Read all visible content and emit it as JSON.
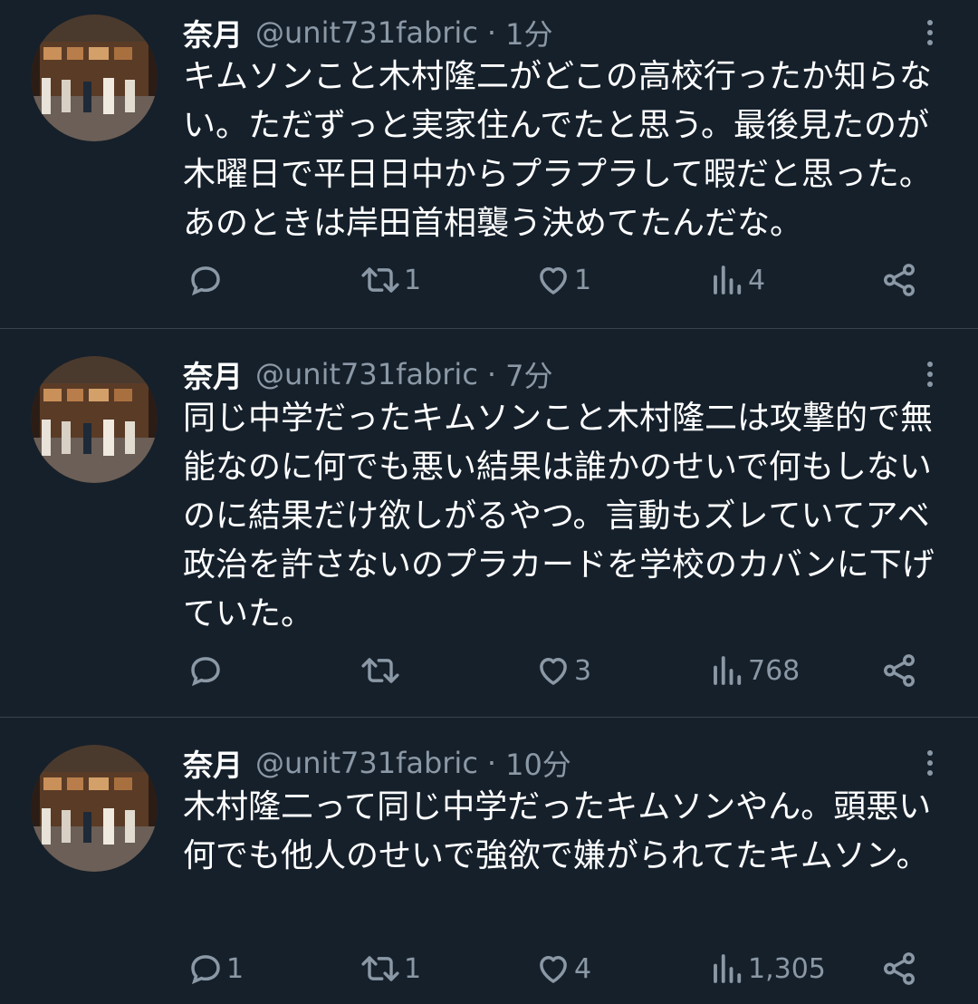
{
  "tweets": [
    {
      "name": "奈月",
      "handle": "@unit731fabric",
      "dot": "·",
      "time": "1分",
      "text": "キムソンこと木村隆二がどこの高校行ったか知らない。ただずっと実家住んでたと思う。最後見たのが木曜日で平日日中からプラプラして暇だと思った。あのときは岸田首相襲う決めてたんだな。",
      "replies": "",
      "retweets": "1",
      "likes": "1",
      "views": "4"
    },
    {
      "name": "奈月",
      "handle": "@unit731fabric",
      "dot": "·",
      "time": "7分",
      "text": "同じ中学だったキムソンこと木村隆二は攻撃的で無能なのに何でも悪い結果は誰かのせいで何もしないのに結果だけ欲しがるやつ。言動もズレていてアベ政治を許さないのプラカードを学校のカバンに下げていた。",
      "replies": "",
      "retweets": "",
      "likes": "3",
      "views": "768"
    },
    {
      "name": "奈月",
      "handle": "@unit731fabric",
      "dot": "·",
      "time": "10分",
      "text": "木村隆二って同じ中学だったキムソンやん。頭悪い何でも他人のせいで強欲で嫌がられてたキムソン。",
      "replies": "1",
      "retweets": "1",
      "likes": "4",
      "views": "1,305"
    }
  ],
  "icons": {
    "reply": "reply-icon",
    "retweet": "retweet-icon",
    "like": "heart-icon",
    "views": "views-chart-icon",
    "share": "share-icon",
    "more": "more-vertical-icon"
  },
  "colors": {
    "background": "#15202b",
    "text": "#ffffff",
    "secondary": "#8b98a5",
    "divider": "#38444d"
  }
}
